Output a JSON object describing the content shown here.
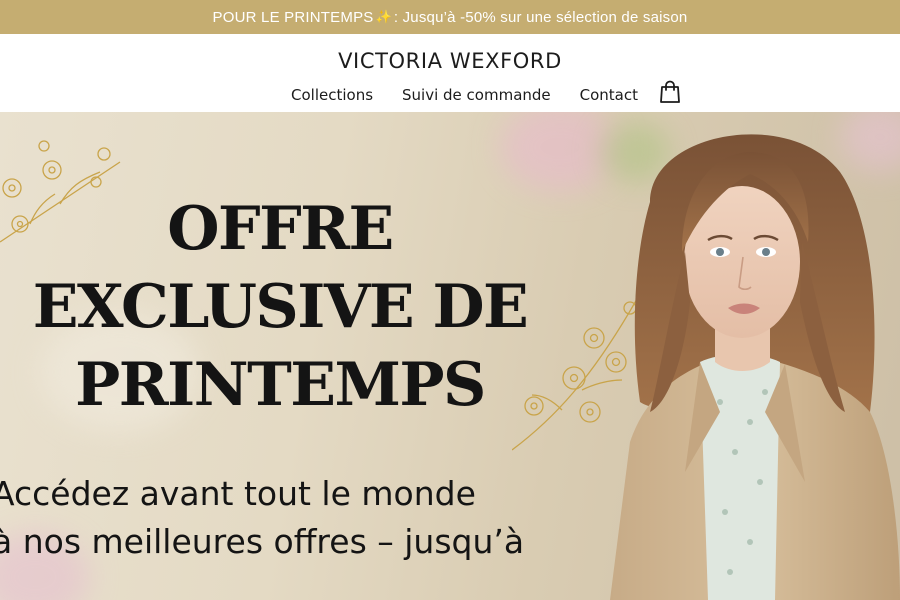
{
  "announcement": {
    "prefix": "POUR LE PRINTEMPS",
    "spark": "✨",
    "suffix": ": Jusqu’à -50% sur une sélection de saison"
  },
  "header": {
    "brand": "VICTORIA WEXFORD",
    "nav": {
      "collections": "Collections",
      "tracking": "Suivi de commande",
      "contact": "Contact"
    },
    "cart_icon": "shopping-bag-icon"
  },
  "hero": {
    "headline": [
      "OFFRE",
      "EXCLUSIVE DE",
      "PRINTEMPS"
    ],
    "subline": [
      "Accédez avant tout le monde",
      "à nos meilleures offres – jusqu’à"
    ]
  },
  "colors": {
    "announcement_bg": "#c5ad71",
    "announcement_text": "#ffffff",
    "text": "#141414",
    "gold_line_art": "#c9a44a"
  }
}
